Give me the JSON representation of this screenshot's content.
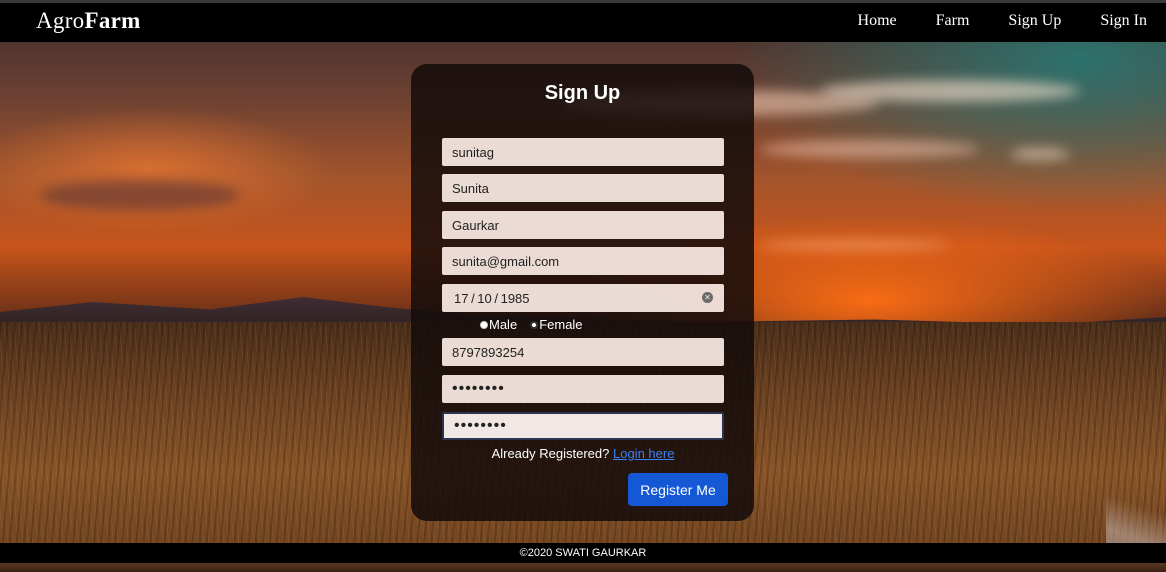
{
  "navbar": {
    "brand_light": "Agro",
    "brand_bold": "Farm",
    "links": [
      "Home",
      "Farm",
      "Sign Up",
      "Sign In"
    ]
  },
  "form": {
    "title": "Sign Up",
    "username": "sunitag",
    "first_name": "Sunita",
    "last_name": "Gaurkar",
    "email": "sunita@gmail.com",
    "dob": "17 / 10 / 1985",
    "gender_options": [
      "Male",
      "Female"
    ],
    "gender_selected": "Female",
    "phone": "8797893254",
    "password": "••••••••",
    "confirm_password": "••••••••",
    "login_prompt": "Already Registered?",
    "login_link": "Login here",
    "submit_label": "Register Me"
  },
  "footer": {
    "copyright": "©2020 SWATI GAURKAR"
  },
  "colors": {
    "navbar_bg": "#000000",
    "card_bg": "#140c0a",
    "button_bg": "#1558d6",
    "link": "#3b82f6"
  },
  "icons": {
    "date_clear": "clear-circle-x-icon"
  }
}
